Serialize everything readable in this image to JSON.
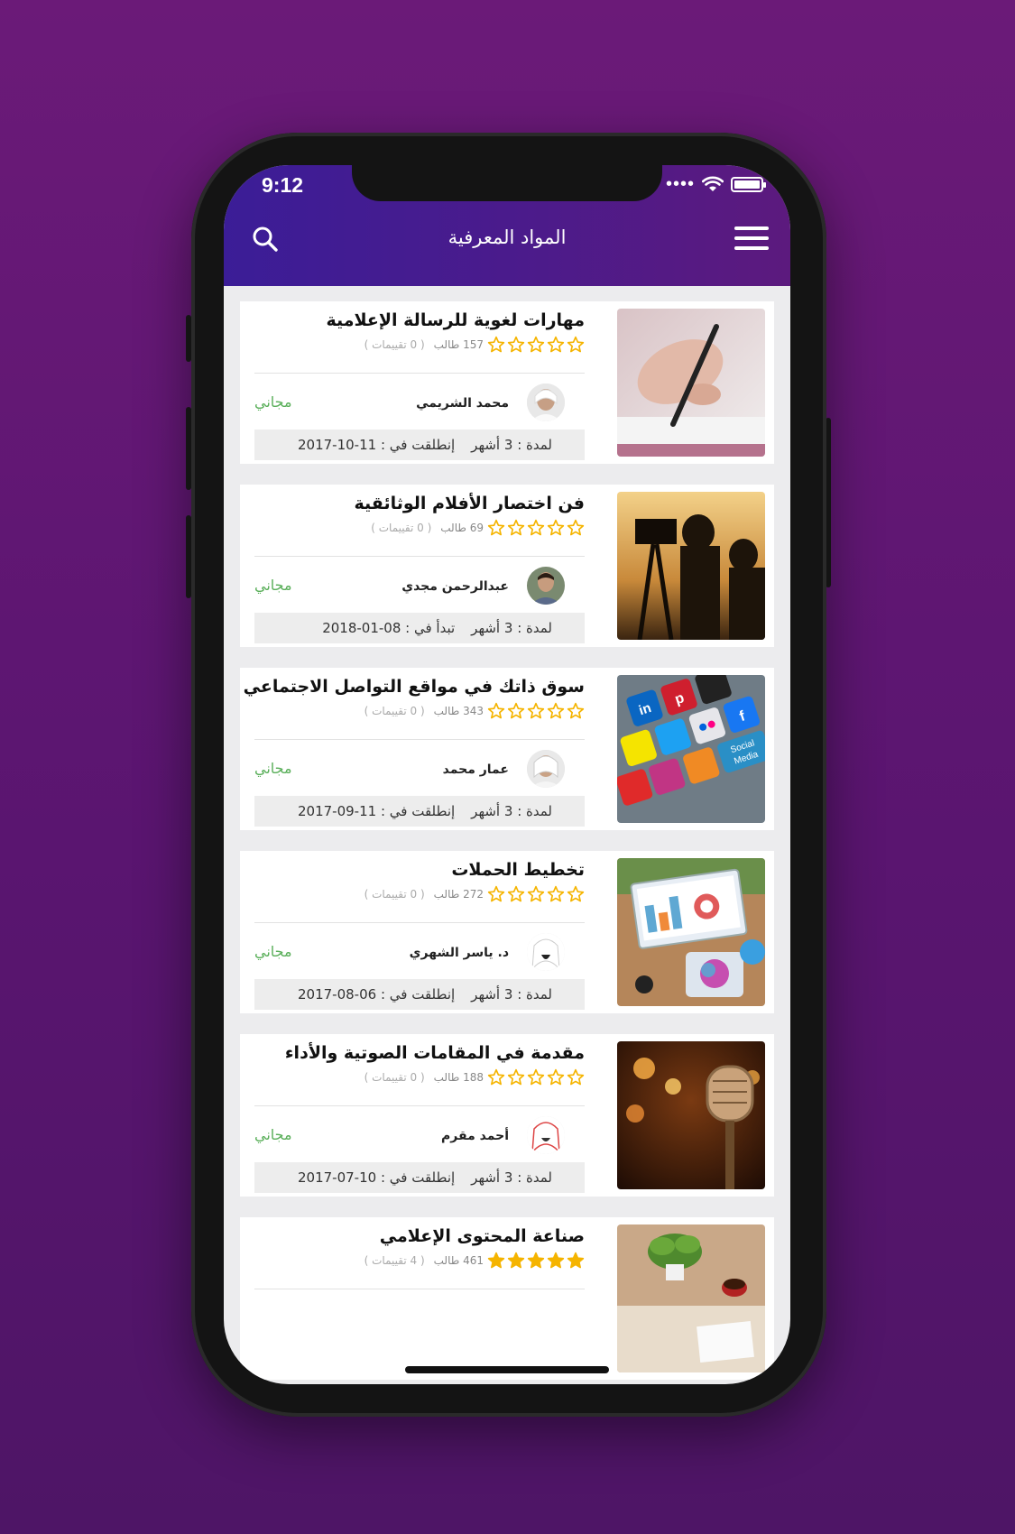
{
  "status_bar": {
    "time": "9:12"
  },
  "header": {
    "title": "المواد المعرفية"
  },
  "courses": [
    {
      "title": "مهارات لغوية للرسالة الإعلامية",
      "stars_filled": 0,
      "students": "157 طالب",
      "ratings": "( 0 تقييمات )",
      "instructor": "محمد الشريمي",
      "price": "مجاني",
      "duration": "لمدة : 3 أشهر",
      "start_label": "إنطلقت في :",
      "start_date": "2017-10-11",
      "image": "pen-writing"
    },
    {
      "title": "فن اختصار الأفلام الوثائقية",
      "stars_filled": 0,
      "students": "69 طالب",
      "ratings": "( 0 تقييمات )",
      "instructor": "عبدالرحمن مجدي",
      "price": "مجاني",
      "duration": "لمدة : 3 أشهر",
      "start_label": "تبدأ في :",
      "start_date": "2018-01-08",
      "image": "camera-crew"
    },
    {
      "title": "سوق ذاتك في مواقع التواصل الاجتماعي",
      "stars_filled": 0,
      "students": "343 طالب",
      "ratings": "( 0 تقييمات )",
      "instructor": "عمار محمد",
      "price": "مجاني",
      "duration": "لمدة : 3 أشهر",
      "start_label": "إنطلقت في :",
      "start_date": "2017-09-11",
      "image": "social-keyboard"
    },
    {
      "title": "تخطيط الحملات",
      "stars_filled": 0,
      "students": "272 طالب",
      "ratings": "( 0 تقييمات )",
      "instructor": "د. ياسر الشهري",
      "price": "مجاني",
      "duration": "لمدة : 3 أشهر",
      "start_label": "إنطلقت في :",
      "start_date": "2017-08-06",
      "image": "desk-laptop"
    },
    {
      "title": "مقدمة في المقامات الصوتية والأداء",
      "stars_filled": 0,
      "students": "188 طالب",
      "ratings": "( 0 تقييمات )",
      "instructor": "أحمد مقرم",
      "price": "مجاني",
      "duration": "لمدة : 3 أشهر",
      "start_label": "إنطلقت في :",
      "start_date": "2017-07-10",
      "image": "microphone"
    },
    {
      "title": "صناعة المحتوى الإعلامي",
      "stars_filled": 5,
      "students": "461 طالب",
      "ratings": "( 4 تقييمات )",
      "instructor": "",
      "price": "",
      "duration": "",
      "start_label": "",
      "start_date": "",
      "image": "plant-desk"
    }
  ],
  "colors": {
    "header_start": "#3b1d97",
    "header_end": "#5c1a7e",
    "star": "#f5b400",
    "price": "#5aaf5a",
    "background": "#6b1a78"
  }
}
